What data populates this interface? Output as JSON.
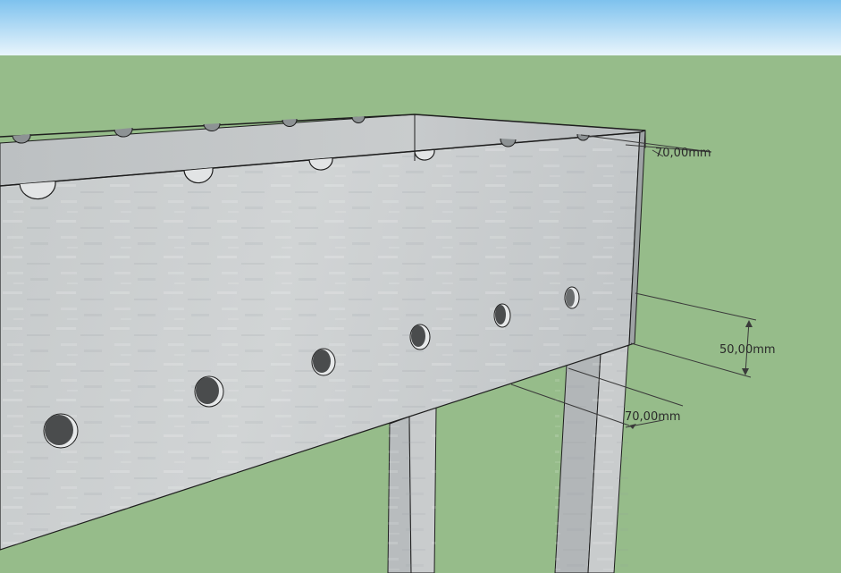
{
  "colors": {
    "sky_top": "#7ec2ee",
    "sky_bottom": "#e9f5fc",
    "ground": "#96bc8a",
    "metal_light": "#cfd2d3",
    "metal_mid": "#b9bdbf",
    "metal_dark": "#a4a9ab",
    "edge": "#1e1e1e",
    "hole": "#4a4c4d",
    "dimension_line": "#3a3a3a"
  },
  "dimensions": {
    "top_notch_offset": "70,00mm",
    "hole_vertical_offset": "50,00mm",
    "leg_width": "70,00mm"
  }
}
